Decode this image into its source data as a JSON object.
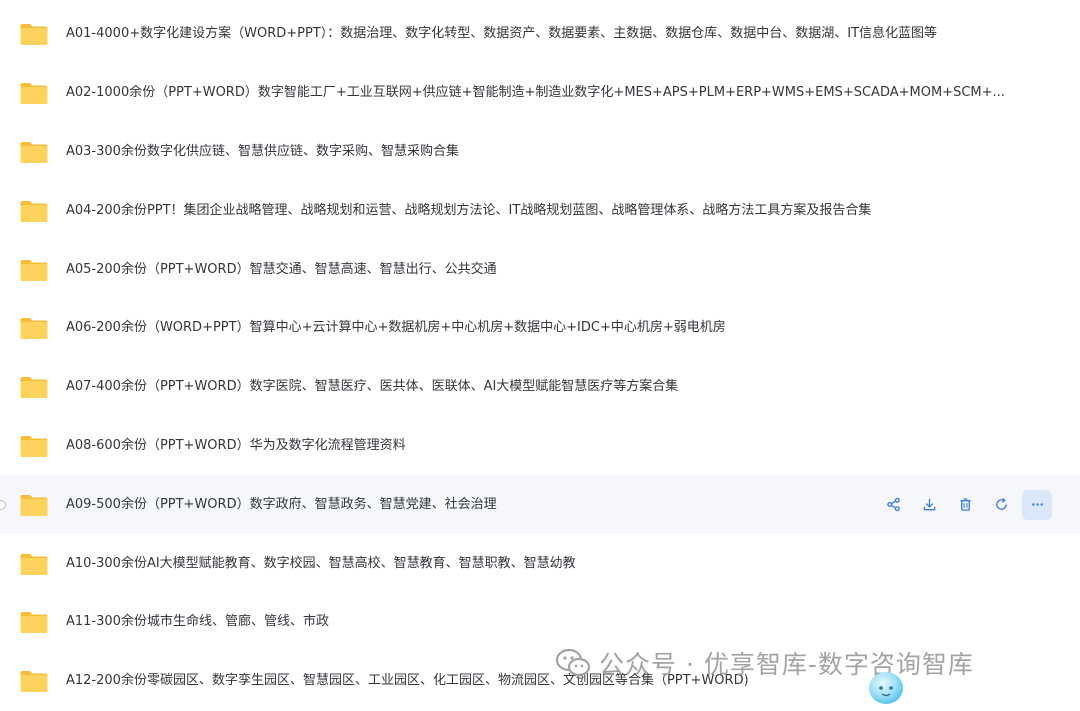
{
  "files": [
    {
      "name": "A01-4000+数字化建设方案（WORD+PPT）：数据治理、数字化转型、数据资产、数据要素、主数据、数据仓库、数据中台、数据湖、IT信息化蓝图等"
    },
    {
      "name": "A02-1000余份（PPT+WORD）数字智能工厂+工业互联网+供应链+智能制造+制造业数字化+MES+APS+PLM+ERP+WMS+EMS+SCADA+MOM+SCM+..."
    },
    {
      "name": "A03-300余份数字化供应链、智慧供应链、数字采购、智慧采购合集"
    },
    {
      "name": "A04-200余份PPT！集团企业战略管理、战略规划和运营、战略规划方法论、IT战略规划蓝图、战略管理体系、战略方法工具方案及报告合集"
    },
    {
      "name": "A05-200余份（PPT+WORD）智慧交通、智慧高速、智慧出行、公共交通"
    },
    {
      "name": "A06-200余份（WORD+PPT）智算中心+云计算中心+数据机房+中心机房+数据中心+IDC+中心机房+弱电机房"
    },
    {
      "name": "A07-400余份（PPT+WORD）数字医院、智慧医疗、医共体、医联体、AI大模型赋能智慧医疗等方案合集"
    },
    {
      "name": "A08-600余份（PPT+WORD）华为及数字化流程管理资料"
    },
    {
      "name": "A09-500余份（PPT+WORD）数字政府、智慧政务、智慧党建、社会治理"
    },
    {
      "name": "A10-300余份AI大模型赋能教育、数字校园、智慧高校、智慧教育、智慧职教、智慧幼教"
    },
    {
      "name": "A11-300余份城市生命线、管廊、管线、市政"
    },
    {
      "name": "A12-200余份零碳园区、数字孪生园区、智慧园区、工业园区、化工园区、物流园区、文创园区等合集（PPT+WORD)"
    }
  ],
  "hovered_row_index": 8,
  "row_actions": [
    {
      "icon": "share-icon"
    },
    {
      "icon": "download-icon"
    },
    {
      "icon": "delete-icon"
    },
    {
      "icon": "refresh-icon"
    },
    {
      "icon": "more-icon"
    }
  ],
  "watermark": {
    "text": "公众号 · 优享智库-数字咨询智库",
    "icon": "wechat-icon"
  },
  "colors": {
    "folder": "#fcd35c",
    "folder_dark": "#f5bd3a",
    "hover_bg": "#f5f7fa",
    "action_icon": "#3b7de0",
    "more_bg": "#dbe8fb",
    "watermark": "#9a9a9a"
  }
}
